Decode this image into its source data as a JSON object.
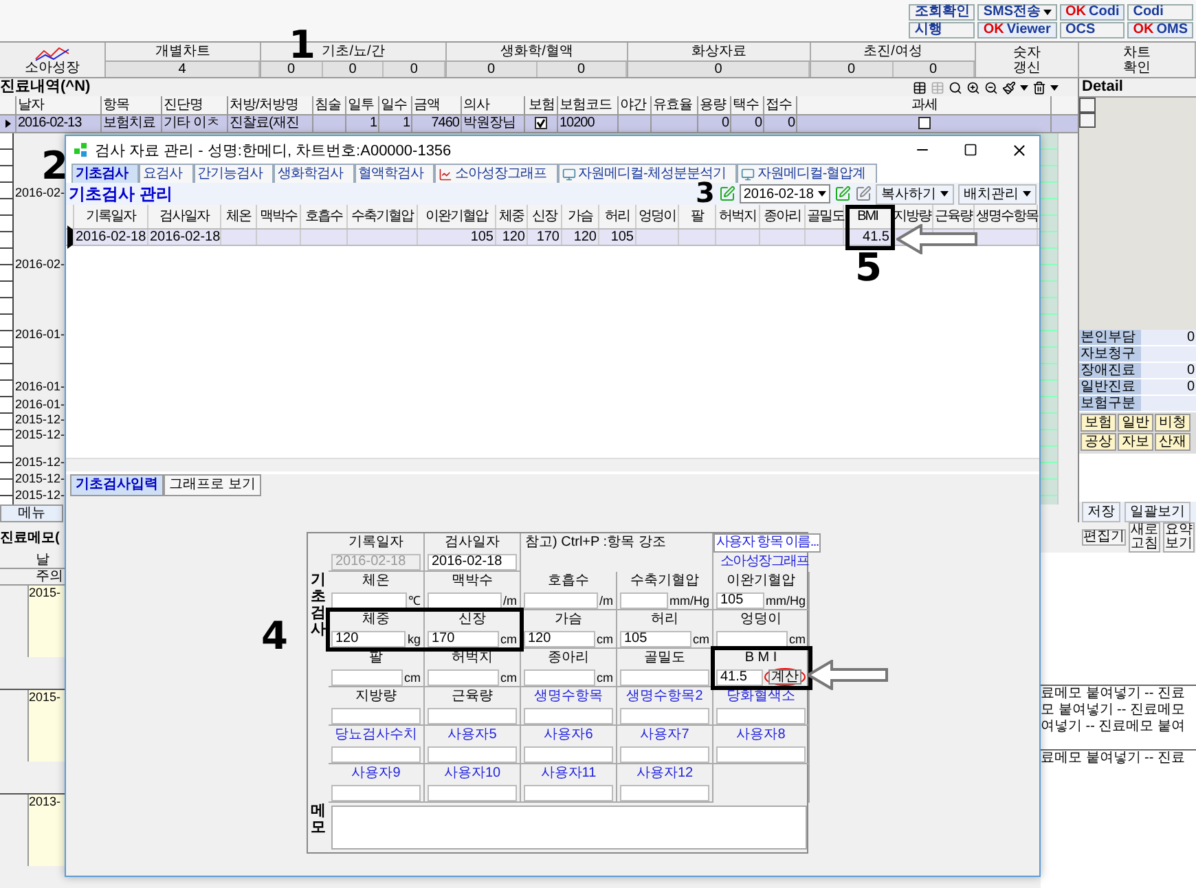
{
  "quick_buttons": [
    {
      "label": "조회확인"
    },
    {
      "label": "SMS전송",
      "dropdown": true
    },
    {
      "badge": "OK",
      "label": "Codi"
    },
    {
      "label": "Codi"
    },
    {
      "label": "시행"
    },
    {
      "badge": "OK",
      "label": "Viewer"
    },
    {
      "label": "OCS"
    },
    {
      "badge": "OK",
      "label": "OMS"
    }
  ],
  "summary": {
    "icon_label": "소아성장",
    "groups": [
      {
        "title": "개별차트",
        "values": [
          "4"
        ]
      },
      {
        "title": "기초/뇨/간",
        "values": [
          "0",
          "0",
          "0"
        ]
      },
      {
        "title": "생화학/혈액",
        "values": [
          "0",
          "0"
        ]
      },
      {
        "title": "화상자료",
        "values": [
          "0"
        ]
      },
      {
        "title": "초진/여성",
        "values": [
          "0",
          "0"
        ]
      }
    ],
    "buttons": [
      "숫자 갱신",
      "차트 확인"
    ]
  },
  "treatment": {
    "title": "진료내역(^N)",
    "row_selected": true,
    "columns": [
      {
        "label": "날자",
        "kind": "text",
        "value": "2016-02-13"
      },
      {
        "label": "항목",
        "kind": "text",
        "value": "보험치료"
      },
      {
        "label": "진단명",
        "kind": "text",
        "value": "기타 이ㅊ"
      },
      {
        "label": "처방/처방명",
        "kind": "text",
        "value": "진찰료(재진"
      },
      {
        "label": "침술",
        "kind": "text"
      },
      {
        "label": "일투",
        "kind": "num",
        "value": "1"
      },
      {
        "label": "일수",
        "kind": "num",
        "value": "1"
      },
      {
        "label": "금액",
        "kind": "num",
        "value": "7460"
      },
      {
        "label": "의사",
        "kind": "text",
        "value": "박원장님"
      },
      {
        "label": "보험",
        "kind": "check",
        "checked": true
      },
      {
        "label": "보험코드",
        "kind": "text",
        "value": "10200"
      },
      {
        "label": "야간",
        "kind": "text"
      },
      {
        "label": "유효율",
        "kind": "text"
      },
      {
        "label": "용량",
        "kind": "num",
        "value": "0"
      },
      {
        "label": "택수",
        "kind": "num",
        "value": "0"
      },
      {
        "label": "접수",
        "kind": "num",
        "value": "0"
      },
      {
        "label": "과세",
        "kind": "check",
        "checked": false
      }
    ],
    "history_dates": [
      "2016-02-",
      "2016-02-",
      "2016-01-",
      "2016-01-",
      "2016-01-",
      "2015-12-",
      "2015-12-",
      "2015-12-",
      "2015-12-",
      "2015-12-"
    ],
    "menu_tab": "메뉴"
  },
  "detail": {
    "title": "Detail",
    "fields": [
      {
        "label": "본인부담",
        "value": "0"
      },
      {
        "label": "자보청구"
      },
      {
        "label": "장애진료",
        "value": "0"
      },
      {
        "label": "일반진료",
        "value": "0"
      },
      {
        "label": "보험구분"
      }
    ],
    "types": [
      "보험",
      "일반",
      "비청",
      "공상",
      "자보",
      "산재"
    ],
    "save": "저장",
    "view_all": "일괄보기"
  },
  "memo": {
    "title": "진료메모(",
    "date_header": "날",
    "note_header": "주의",
    "entries": [
      {
        "date": "2015-"
      },
      {
        "date": "2015-"
      },
      {
        "date": "2013-"
      }
    ],
    "buttons": [
      "편집기",
      "새로 고침",
      "요약 보기"
    ],
    "paste_groups": [
      [
        "료메모 붙여넣기 -- 진료",
        "모 붙여넣기 -- 진료메모",
        "여넣기 -- 진료메모 붙여"
      ],
      [
        "료메모 붙여넣기 -- 진료"
      ]
    ]
  },
  "dialog": {
    "title": "검사 자료 관리 - 성명:한메디, 차트번호:A00000-1356",
    "tabs": [
      {
        "label": "기초검사",
        "selected": true,
        "kind": "plain"
      },
      {
        "label": "요검사",
        "selected": false,
        "kind": "plain"
      },
      {
        "label": "간기능검사",
        "selected": false,
        "kind": "plain"
      },
      {
        "label": "생화학검사",
        "selected": false,
        "kind": "plain"
      },
      {
        "label": "혈액학검사",
        "selected": false,
        "kind": "plain"
      },
      {
        "label": "소아성장그래프",
        "selected": false,
        "kind": "chart"
      },
      {
        "label": "자원메디컬-체성분분석기",
        "selected": false,
        "kind": "device"
      },
      {
        "label": "자원메디컬-혈압계",
        "selected": false,
        "kind": "device"
      }
    ],
    "heading": "기초검사 관리",
    "date": "2016-02-18",
    "copy_button": "복사하기",
    "batch_button": "배치관리",
    "grid": {
      "row_selected": true,
      "columns": [
        {
          "label": "기록일자",
          "value": "2016-02-18"
        },
        {
          "label": "검사일자",
          "value": "2016-02-18"
        },
        {
          "label": "체온"
        },
        {
          "label": "맥박수"
        },
        {
          "label": "호흡수"
        },
        {
          "label": "수축기혈압"
        },
        {
          "label": "이완기혈압",
          "value": "105"
        },
        {
          "label": "체중",
          "value": "120"
        },
        {
          "label": "신장",
          "value": "170"
        },
        {
          "label": "가슴",
          "value": "120"
        },
        {
          "label": "허리",
          "value": "105"
        },
        {
          "label": "엉덩이"
        },
        {
          "label": "팔"
        },
        {
          "label": "허벅지"
        },
        {
          "label": "종아리"
        },
        {
          "label": "골밀도"
        },
        {
          "label": "BMI",
          "value": "41.5"
        },
        {
          "label": "지방량"
        },
        {
          "label": "근육량"
        },
        {
          "label": "생명수항목"
        }
      ]
    },
    "bottom_tabs": [
      {
        "label": "기초검사입력",
        "selected": true
      },
      {
        "label": "그래프로 보기",
        "selected": false
      }
    ],
    "form": {
      "recorded_label": "기록일자",
      "recorded": {
        "value": "2016-02-18",
        "disabled": true
      },
      "tested_label": "검사일자",
      "tested": {
        "value": "2016-02-18",
        "disabled": false
      },
      "hint": "참고) Ctrl+P :항목 강조",
      "custom_names_button": "사용자 항목 이름...",
      "growth_link": "소아성장그래프",
      "side_label": "기초검사",
      "memo_label": "메모",
      "fields": [
        {
          "label": "체온",
          "unit": "℃",
          "custom": false
        },
        {
          "label": "맥박수",
          "unit": "/m",
          "custom": false
        },
        {
          "label": "호흡수",
          "unit": "/m",
          "custom": false
        },
        {
          "label": "수축기혈압",
          "unit": "mm/Hg",
          "custom": false
        },
        {
          "label": "이완기혈압",
          "value": "105",
          "unit": "mm/Hg",
          "custom": false
        },
        {
          "label": "체중",
          "value": "120",
          "unit": "kg",
          "custom": false
        },
        {
          "label": "신장",
          "value": "170",
          "unit": "cm",
          "custom": false
        },
        {
          "label": "가슴",
          "value": "120",
          "unit": "cm",
          "custom": false
        },
        {
          "label": "허리",
          "value": "105",
          "unit": "cm",
          "custom": false
        },
        {
          "label": "엉덩이",
          "unit": "cm",
          "custom": false
        },
        {
          "label": "팔",
          "unit": "cm",
          "custom": false
        },
        {
          "label": "허벅지",
          "unit": "cm",
          "custom": false
        },
        {
          "label": "종아리",
          "unit": "cm",
          "custom": false
        },
        {
          "label": "골밀도",
          "custom": false
        },
        {
          "label": "B M I",
          "value": "41.5",
          "action": "계산",
          "custom": false
        },
        {
          "label": "지방량",
          "custom": false
        },
        {
          "label": "근육량",
          "custom": false
        },
        {
          "label": "생명수항목",
          "custom": true
        },
        {
          "label": "생명수항목2",
          "custom": true
        },
        {
          "label": "당화혈색소",
          "custom": true
        },
        {
          "label": "당뇨검사수치",
          "custom": true
        },
        {
          "label": "사용자5",
          "custom": true
        },
        {
          "label": "사용자6",
          "custom": true
        },
        {
          "label": "사용자7",
          "custom": true
        },
        {
          "label": "사용자8",
          "custom": true
        },
        {
          "label": "사용자9",
          "custom": true
        },
        {
          "label": "사용자10",
          "custom": true
        },
        {
          "label": "사용자11",
          "custom": true
        },
        {
          "label": "사용자12",
          "custom": true
        }
      ]
    }
  },
  "annotations": [
    "1",
    "2",
    "3",
    "4",
    "5"
  ]
}
